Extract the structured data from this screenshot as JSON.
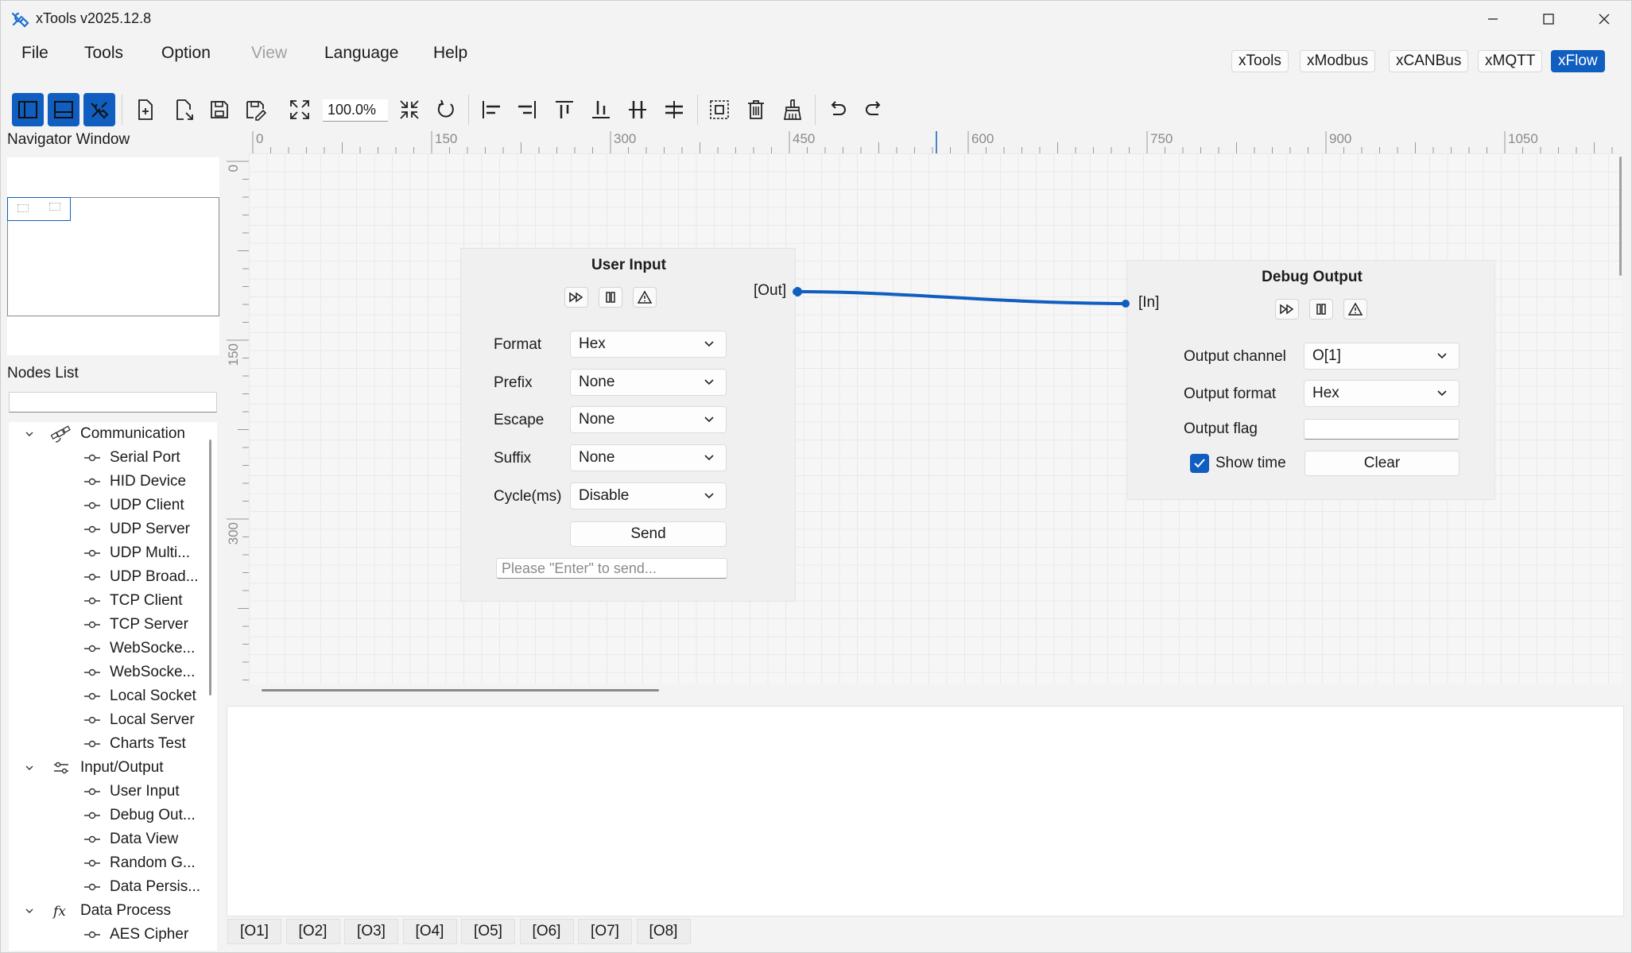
{
  "window": {
    "title": "xTools v2025.12.8"
  },
  "menu": {
    "items": [
      "File",
      "Tools",
      "Option",
      "View",
      "Language",
      "Help"
    ],
    "disabled": [
      "View"
    ]
  },
  "tool_tabs": {
    "items": [
      "xTools",
      "xModbus",
      "xCANBus",
      "xMQTT",
      "xFlow"
    ],
    "active": "xFlow"
  },
  "toolbar": {
    "zoom": "100.0%"
  },
  "navigator": {
    "label": "Navigator Window"
  },
  "nodes_list": {
    "label": "Nodes List",
    "search_value": "",
    "groups": [
      {
        "label": "Communication",
        "icon": "satellite-icon",
        "items": [
          "Serial Port",
          "HID Device",
          "UDP Client",
          "UDP Server",
          "UDP Multi...",
          "UDP Broad...",
          "TCP Client",
          "TCP Server",
          "WebSocke...",
          "WebSocke...",
          "Local Socket",
          "Local Server",
          "Charts Test"
        ]
      },
      {
        "label": "Input/Output",
        "icon": "sliders-icon",
        "items": [
          "User Input",
          "Debug Out...",
          "Data View",
          "Random G...",
          "Data Persis..."
        ]
      },
      {
        "label": "Data Process",
        "icon": "function-icon",
        "items": [
          "AES Cipher"
        ]
      }
    ]
  },
  "rulers": {
    "top_labels": [
      "0",
      "150",
      "300",
      "450",
      "600",
      "750",
      "900",
      "1050"
    ],
    "left_labels": [
      "0",
      "150",
      "300"
    ]
  },
  "user_input_node": {
    "title": "User Input",
    "port_out": "[Out]",
    "fields": [
      {
        "label": "Format",
        "value": "Hex"
      },
      {
        "label": "Prefix",
        "value": "None"
      },
      {
        "label": "Escape",
        "value": "None"
      },
      {
        "label": "Suffix",
        "value": "None"
      },
      {
        "label": "Cycle(ms)",
        "value": "Disable"
      }
    ],
    "send_label": "Send",
    "input_placeholder": "Please \"Enter\" to send..."
  },
  "debug_output_node": {
    "title": "Debug Output",
    "port_in": "[In]",
    "output_channel_label": "Output channel",
    "output_channel_value": "O[1]",
    "output_format_label": "Output format",
    "output_format_value": "Hex",
    "output_flag_label": "Output flag",
    "output_flag_value": "",
    "show_time_label": "Show time",
    "show_time_checked": true,
    "clear_label": "Clear"
  },
  "output_tabs": [
    "[O1]",
    "[O2]",
    "[O3]",
    "[O4]",
    "[O5]",
    "[O6]",
    "[O7]",
    "[O8]"
  ],
  "colors": {
    "accent": "#0f5ec0",
    "connection": "#0f5ec0"
  }
}
